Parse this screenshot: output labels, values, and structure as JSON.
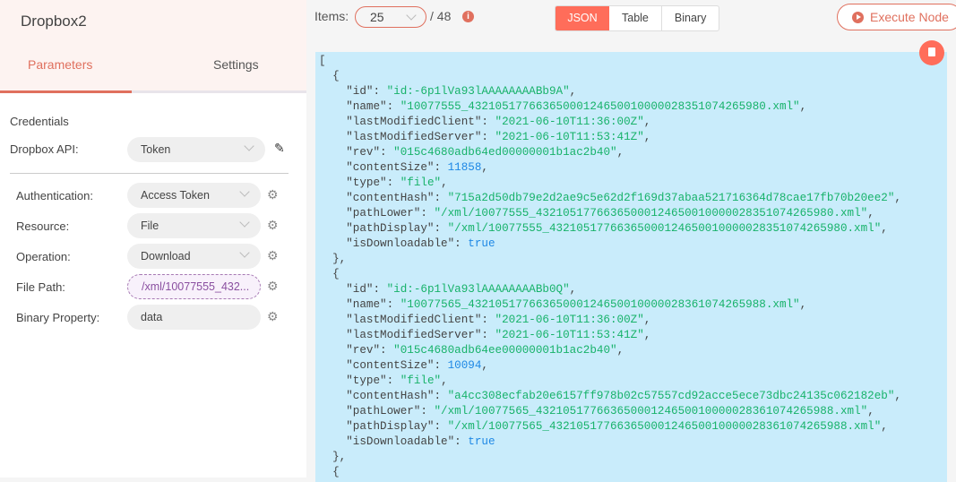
{
  "node": {
    "title": "Dropbox2",
    "tabs": [
      {
        "label": "Parameters",
        "active": true
      },
      {
        "label": "Settings",
        "active": false
      }
    ]
  },
  "credentials": {
    "heading": "Credentials",
    "label": "Dropbox API:",
    "value": "Token",
    "edit_icon": "pencil-icon"
  },
  "params": [
    {
      "label": "Authentication:",
      "value": "Access Token",
      "type": "select"
    },
    {
      "label": "Resource:",
      "value": "File",
      "type": "select"
    },
    {
      "label": "Operation:",
      "value": "Download",
      "type": "select"
    },
    {
      "label": "File Path:",
      "value": "/xml/10077555_432...",
      "type": "expression"
    },
    {
      "label": "Binary Property:",
      "value": "data",
      "type": "text"
    }
  ],
  "output": {
    "items_label": "Items:",
    "items_value": "25",
    "total": "/ 48",
    "info_icon": "i",
    "views": [
      {
        "label": "JSON",
        "active": true
      },
      {
        "label": "Table",
        "active": false
      },
      {
        "label": "Binary",
        "active": false
      }
    ],
    "execute_label": "Execute Node",
    "accent": "#ff6d5a"
  },
  "json_records": [
    [
      [
        "id",
        "id:-6p1lVa93lAAAAAAAABb9A",
        "s"
      ],
      [
        "name",
        "10077555_43210517766365000124650010000028351074265980.xml",
        "s"
      ],
      [
        "lastModifiedClient",
        "2021-06-10T11:36:00Z",
        "s"
      ],
      [
        "lastModifiedServer",
        "2021-06-10T11:53:41Z",
        "s"
      ],
      [
        "rev",
        "015c4680adb64ed00000001b1ac2b40",
        "s"
      ],
      [
        "contentSize",
        "11858",
        "n"
      ],
      [
        "type",
        "file",
        "s"
      ],
      [
        "contentHash",
        "715a2d50db79e2d2ae9c5e62d2f169d37abaa521716364d78cae17fb70b20ee2",
        "s"
      ],
      [
        "pathLower",
        "/xml/10077555_43210517766365000124650010000028351074265980.xml",
        "s"
      ],
      [
        "pathDisplay",
        "/xml/10077555_43210517766365000124650010000028351074265980.xml",
        "s"
      ],
      [
        "isDownloadable",
        "true",
        "b"
      ]
    ],
    [
      [
        "id",
        "id:-6p1lVa93lAAAAAAAABb0Q",
        "s"
      ],
      [
        "name",
        "10077565_43210517766365000124650010000028361074265988.xml",
        "s"
      ],
      [
        "lastModifiedClient",
        "2021-06-10T11:36:00Z",
        "s"
      ],
      [
        "lastModifiedServer",
        "2021-06-10T11:53:41Z",
        "s"
      ],
      [
        "rev",
        "015c4680adb64ee00000001b1ac2b40",
        "s"
      ],
      [
        "contentSize",
        "10094",
        "n"
      ],
      [
        "type",
        "file",
        "s"
      ],
      [
        "contentHash",
        "a4cc308ecfab20e6157ff978b02c57557cd92acce5ece73dbc24135c062182eb",
        "s"
      ],
      [
        "pathLower",
        "/xml/10077565_43210517766365000124650010000028361074265988.xml",
        "s"
      ],
      [
        "pathDisplay",
        "/xml/10077565_43210517766365000124650010000028361074265988.xml",
        "s"
      ],
      [
        "isDownloadable",
        "true",
        "b"
      ]
    ]
  ]
}
